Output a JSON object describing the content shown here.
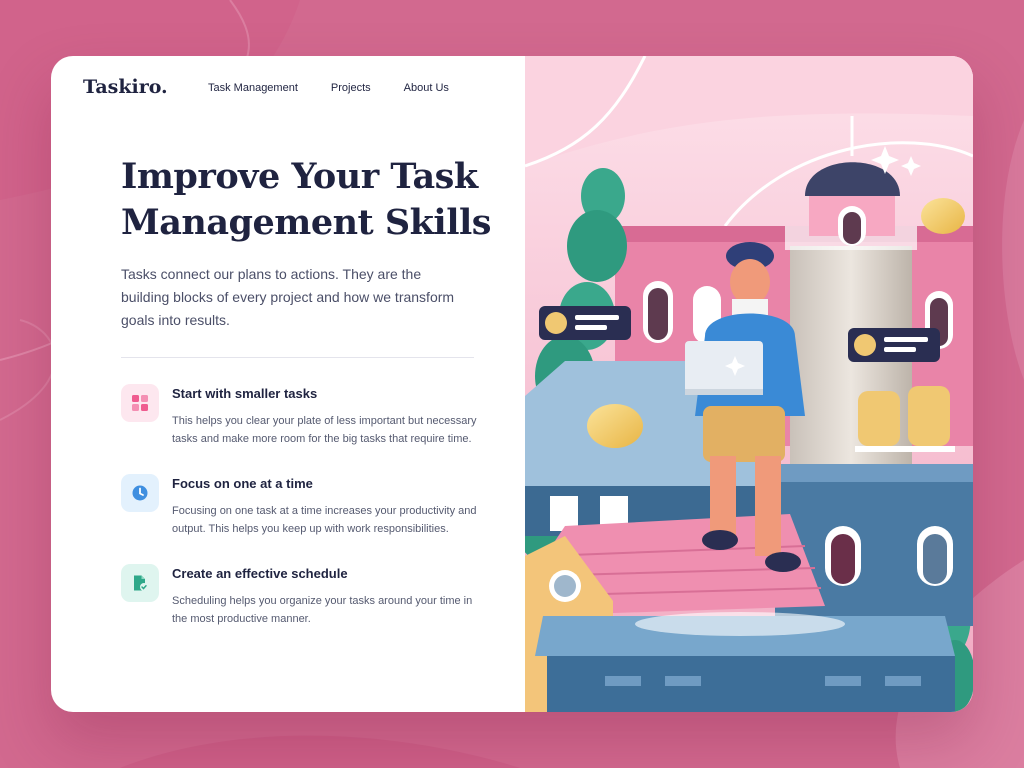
{
  "brand": {
    "logo": "Taskiro."
  },
  "nav": [
    "Task Management",
    "Projects",
    "About Us"
  ],
  "hero": {
    "title": "Improve Your Task Management Skills",
    "description": "Tasks connect our plans to actions. They are the building blocks of every project and how we transform goals into results."
  },
  "features": [
    {
      "title": "Start with smaller tasks",
      "text": "This helps you clear your plate of less important but necessary tasks and make more room for the big tasks that require time.",
      "icon": "grid-icon",
      "icon_bg": "#fde7ef",
      "icon_color": "#ef5b8f"
    },
    {
      "title": "Focus on one at a time",
      "text": "Focusing on one task at a time increases your productivity and output. This helps you keep up with work responsibilities.",
      "icon": "clock-icon",
      "icon_bg": "#e3f1fd",
      "icon_color": "#3f8fe0"
    },
    {
      "title": "Create an effective schedule",
      "text": "Scheduling helps you organize your tasks around your time in the most productive manner.",
      "icon": "document-check-icon",
      "icon_bg": "#dff5ef",
      "icon_color": "#2fa889"
    }
  ],
  "colors": {
    "page_background": "#d2698f",
    "heading": "#1f2340",
    "illustration_background": "#f6c6d6"
  }
}
